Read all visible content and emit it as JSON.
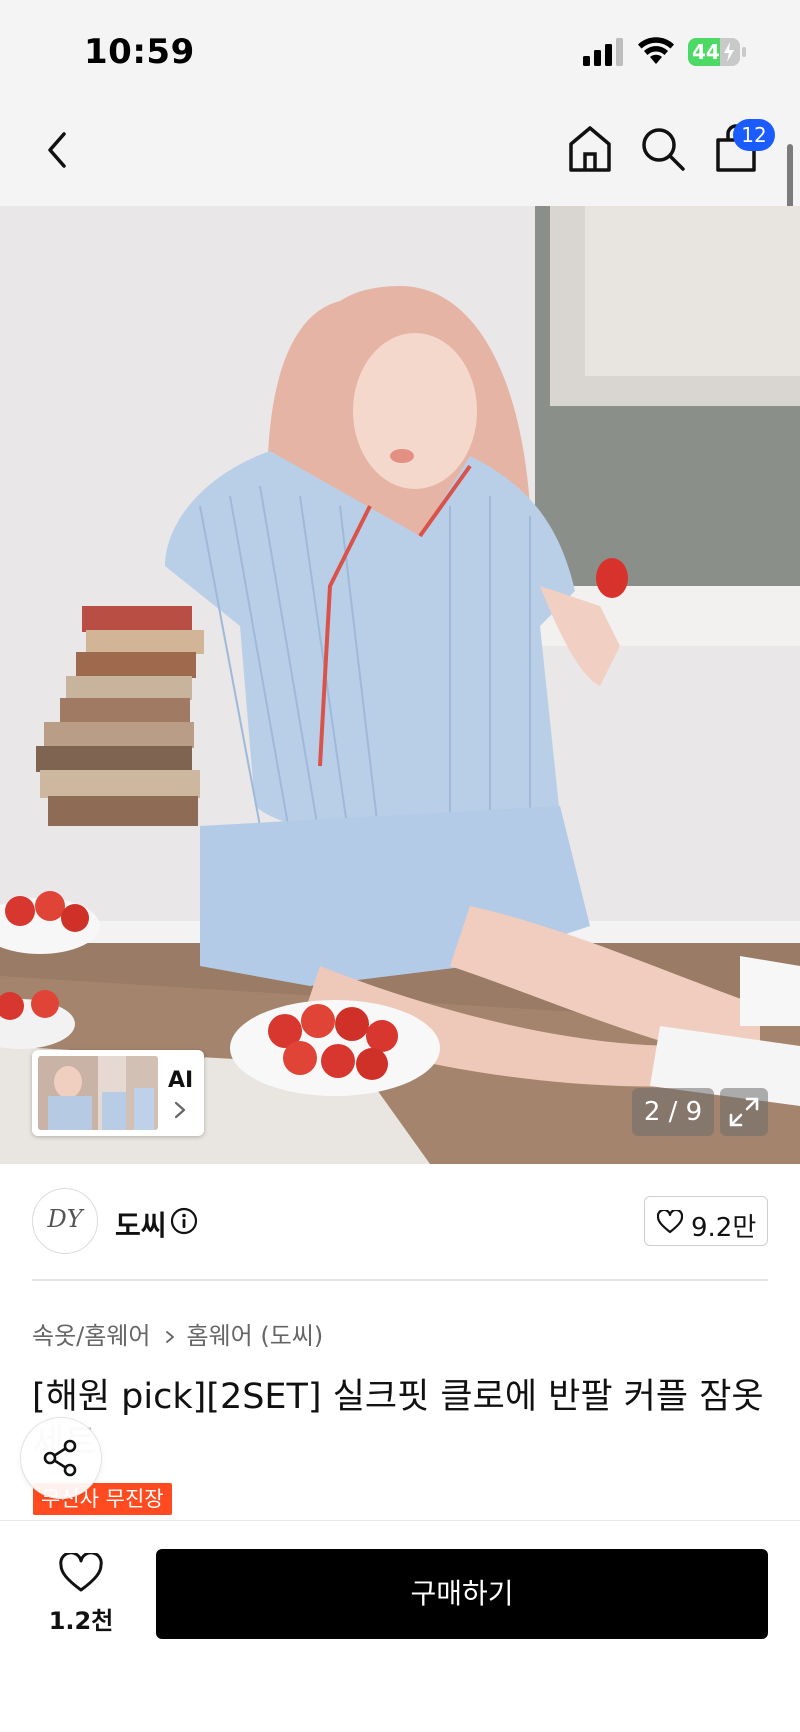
{
  "status_bar": {
    "time": "10:59",
    "battery_level": "44"
  },
  "nav": {
    "cart_count": "12"
  },
  "gallery": {
    "ai_label": "AI",
    "counter": "2 / 9"
  },
  "brand": {
    "logo_text": "DY",
    "name": "도씨",
    "like_count": "9.2만"
  },
  "product": {
    "breadcrumb": [
      "속옷/홈웨어",
      "홈웨어 (도씨)"
    ],
    "title_line1": "[해원 pick][2SET] 실크핏 클로에 반팔 커플 잠옷",
    "title_line2": "세트",
    "tag": "무신사 무진장"
  },
  "bottom_bar": {
    "wish_count": "1.2천",
    "buy_label": "구매하기"
  },
  "colors": {
    "accent": "#1a5cff",
    "tag_bg": "#ff4b1f",
    "buy_bg": "#000000"
  },
  "icons": [
    "back-arrow-icon",
    "home-icon",
    "search-icon",
    "bag-icon",
    "expand-icon",
    "info-icon",
    "heart-icon",
    "share-icon",
    "chevron-right-icon"
  ]
}
